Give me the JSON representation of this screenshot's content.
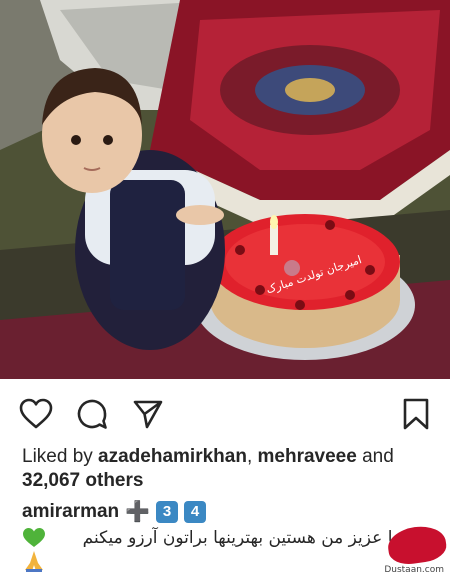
{
  "post": {
    "photo_alt": "",
    "likes": {
      "prefix": "Liked by ",
      "user1": "azadehamirkhan",
      "sep": ", ",
      "user2": "mehraveee",
      "and": " and",
      "count_line": "32,067 others"
    },
    "caption": {
      "username": "amirarman",
      "emojis": [
        "➕",
        "3",
        "4"
      ],
      "text": "ما عزیز من هستین بهترینها براتون آرزو میکنم",
      "cake_text": "امیرجان تولدت مبارک"
    },
    "icons": {
      "like": "heart-icon",
      "comment": "comment-icon",
      "share": "share-icon",
      "save": "bookmark-icon"
    },
    "watermark": {
      "site": "Dustaan.com"
    }
  }
}
